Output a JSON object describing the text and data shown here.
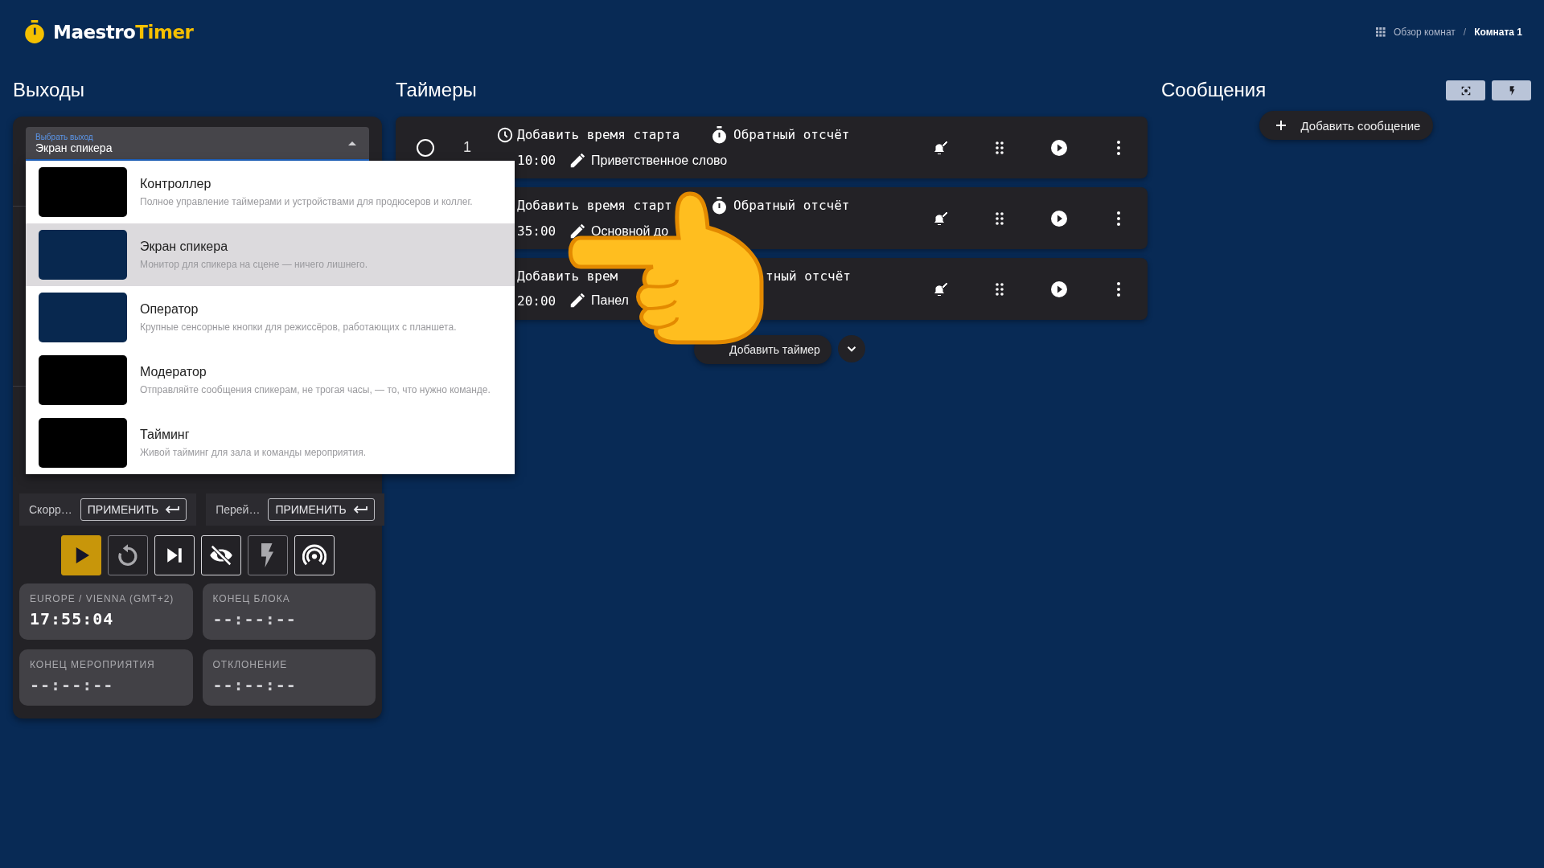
{
  "header": {
    "logo_main": "Maestro",
    "logo_accent": "Timer",
    "breadcrumb": [
      {
        "label": "Обзор комнат",
        "current": false
      },
      {
        "label": "Комната 1",
        "current": true
      }
    ],
    "separator": "/"
  },
  "outputs": {
    "title": "Выходы",
    "select": {
      "label": "Выбрать выход",
      "value": "Экран спикера",
      "expanded": true
    },
    "options": [
      {
        "name": "Контроллер",
        "description": "Полное управление таймерами и устройствами для продюсеров и коллег.",
        "color": "#000000",
        "selected": false
      },
      {
        "name": "Экран спикера",
        "description": "Монитор для спикера на сцене — ничего лишнего.",
        "color": "#08284f",
        "selected": true
      },
      {
        "name": "Оператор",
        "description": "Крупные сенсорные кнопки для режиссёров, работающих с планшета.",
        "color": "#08284f",
        "selected": false
      },
      {
        "name": "Модератор",
        "description": "Отправляйте сообщения спикерам, не трогая часы, — то, что нужно команде.",
        "color": "#000000",
        "selected": false
      },
      {
        "name": "Тайминг",
        "description": "Живой тайминг для зала и команды мероприятия.",
        "color": "#000000",
        "selected": false
      }
    ],
    "apply": [
      {
        "label": "Скорр…",
        "button": "ПРИМЕНИТЬ"
      },
      {
        "label": "Перей…",
        "button": "ПРИМЕНИТЬ"
      }
    ],
    "controls": [
      {
        "kind": "play",
        "active": true,
        "disabled": false
      },
      {
        "kind": "reset",
        "active": false,
        "disabled": true
      },
      {
        "kind": "next",
        "active": false,
        "disabled": false
      },
      {
        "kind": "hide",
        "active": false,
        "disabled": false
      },
      {
        "kind": "flash",
        "active": false,
        "disabled": true
      },
      {
        "kind": "broadcast",
        "active": false,
        "disabled": false
      }
    ],
    "clocks": [
      {
        "label": "EUROPE / VIENNA (GMT+2)",
        "value": "17:55:04",
        "live": true
      },
      {
        "label": "КОНЕЦ БЛОКА",
        "value": "--:--:--",
        "live": false
      },
      {
        "label": "КОНЕЦ МЕРОПРИЯТИЯ",
        "value": "--:--:--",
        "live": false
      },
      {
        "label": "ОТКЛОНЕНИЕ",
        "value": "--:--:--",
        "live": false
      }
    ]
  },
  "timers": {
    "title": "Таймеры",
    "rows": [
      {
        "number": "1",
        "selected": false,
        "start": "Добавить время старта",
        "start_icon": true,
        "countdown": "Обратный отсчёт",
        "countdown_icon": true,
        "duration": "10:00",
        "duration_icon": false,
        "title": "Приветственное слово"
      },
      {
        "start": "Добавить время старт",
        "start_icon": false,
        "countdown": "Обратный отсчёт",
        "countdown_icon": true,
        "duration": "35:00",
        "duration_icon": false,
        "title": "Основной до"
      },
      {
        "start": "Добавить врем",
        "start_icon": false,
        "countdown": "тный отсчёт",
        "countdown_icon": false,
        "duration": "20:00",
        "duration_icon": false,
        "title": "Панел"
      }
    ],
    "add_button": "Добавить таймер"
  },
  "messages": {
    "title": "Сообщения",
    "add_button": "Добавить сообщение"
  }
}
